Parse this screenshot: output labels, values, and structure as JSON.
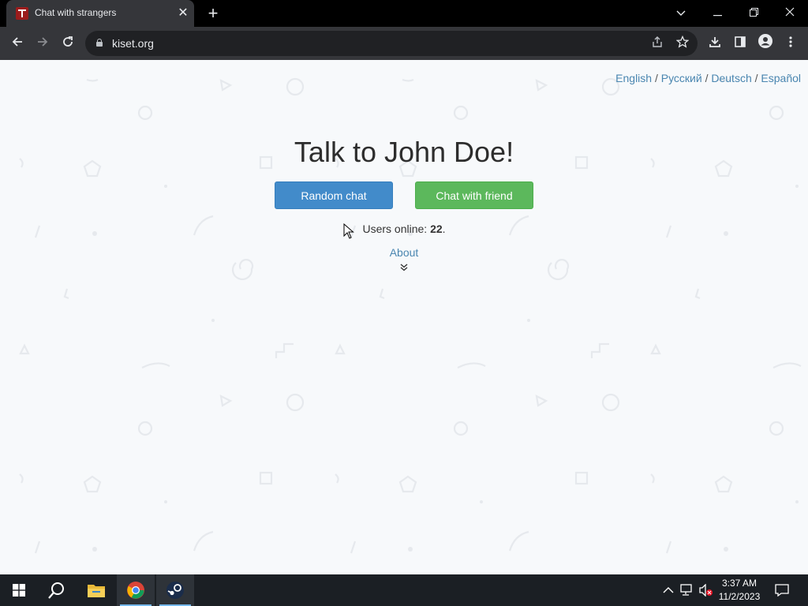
{
  "browser": {
    "tab": {
      "title": "Chat with strangers",
      "close": "✕"
    },
    "new_tab": "+",
    "window": {
      "minimize": "—",
      "restore": "❐",
      "close": "✕",
      "tab_search": "⌄"
    },
    "url": "kiset.org"
  },
  "page": {
    "languages": [
      "English",
      "Русский",
      "Deutsch",
      "Español"
    ],
    "separator": "/",
    "headline": "Talk to John Doe!",
    "random_chat": "Random chat",
    "chat_with_friend": "Chat with friend",
    "users_online_label": "Users online:",
    "users_online_count": "22",
    "users_online_suffix": ".",
    "about": "About",
    "colors": {
      "blue": "#428bca",
      "green": "#5cb85c",
      "link": "#4a86b0"
    }
  },
  "taskbar": {
    "time": "3:37 AM",
    "date": "11/2/2023",
    "apps": [
      "start-icon",
      "search-icon",
      "file-explorer-icon",
      "chrome-icon",
      "steam-icon"
    ]
  }
}
